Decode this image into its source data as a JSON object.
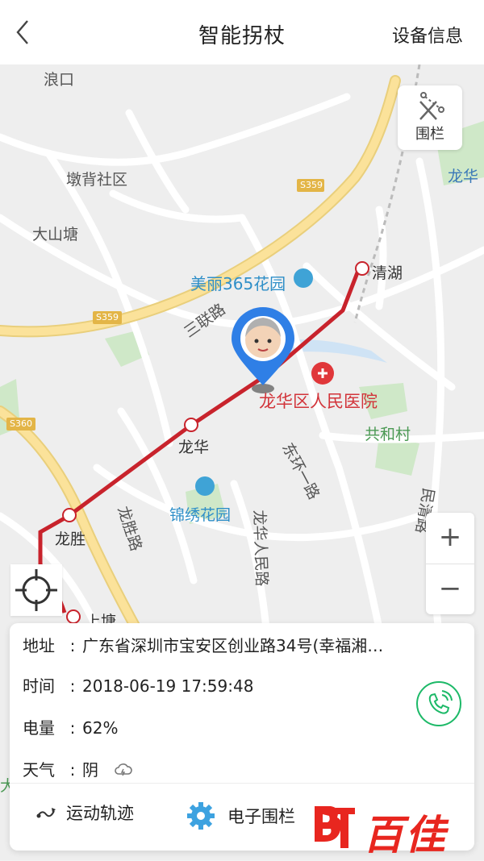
{
  "header": {
    "title": "智能拐杖",
    "right_link": "设备信息"
  },
  "map": {
    "labels": {
      "langkou": "浪口",
      "dunbei": "墩背社区",
      "dashantang": "大山塘",
      "longhua_tr": "龙华",
      "meili": "美丽365花园",
      "qinghu": "清湖",
      "sanlian": "三联路",
      "hospital": "龙华区人民医院",
      "gonghe": "共和村",
      "longhua_stn": "龙华",
      "dong1": "东环一路",
      "jinxiu": "锦绣花园",
      "longsheng_rd": "龙胜路",
      "longhua_rm": "龙华人民路",
      "minqing": "民清路",
      "longsheng_stn": "龙胜",
      "shangtang": "上塘",
      "s359a": "S359",
      "s359b": "S359",
      "s360": "S360",
      "da": "大"
    },
    "fence_button": "围栏",
    "zoom_in": "+",
    "zoom_out": "−"
  },
  "info": {
    "address_label": "地址",
    "address_value": "广东省深圳市宝安区创业路34号(幸福湘…",
    "time_label": "时间",
    "time_value": "2018-06-19  17:59:48",
    "battery_label": "电量",
    "battery_value": "62%",
    "weather_label": "天气",
    "weather_value": "阴",
    "colon": ":"
  },
  "actions": {
    "track": "运动轨迹",
    "fence": "电子围栏"
  },
  "brand": {
    "text": "百佳"
  },
  "colors": {
    "route": "#c8232c",
    "marker": "#2f7fe6",
    "phone": "#1db968",
    "gear": "#3da2e0",
    "brand": "#e8261f"
  }
}
